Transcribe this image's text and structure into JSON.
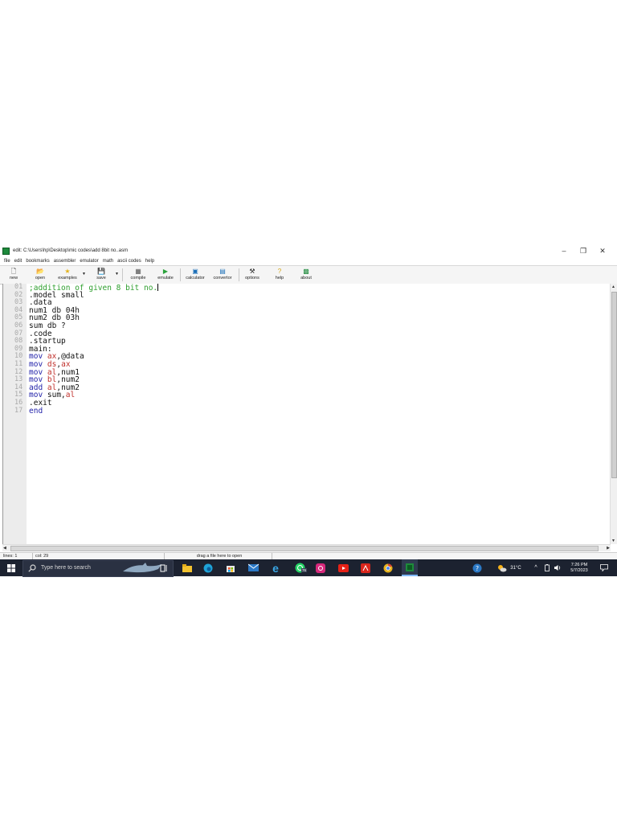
{
  "window": {
    "title": "edit: C:\\Users\\hp\\Desktop\\mic codes\\add 8bit no..asm",
    "controls": [
      "–",
      "❐",
      "✕"
    ]
  },
  "menu": [
    "file",
    "edit",
    "bookmarks",
    "assembler",
    "emulator",
    "math",
    "ascii codes",
    "help"
  ],
  "toolbar": {
    "new": "new",
    "open": "open",
    "examples": "examples",
    "save": "save",
    "compile": "compile",
    "emulate": "emulate",
    "calculator": "calculator",
    "convertor": "convertor",
    "options": "options",
    "help": "help",
    "about": "about"
  },
  "editor": {
    "colors": {
      "comment": "#2e9e2e",
      "keyword": "#1f1fa8",
      "register": "#c0302b",
      "text": "#111111"
    },
    "lines": [
      {
        "n": "01",
        "segments": [
          {
            "t": ";addition of given 8 bit no.",
            "c": "comment"
          }
        ]
      },
      {
        "n": "02",
        "segments": [
          {
            "t": ".model small",
            "c": "text"
          }
        ]
      },
      {
        "n": "03",
        "segments": [
          {
            "t": ".data",
            "c": "text"
          }
        ]
      },
      {
        "n": "04",
        "segments": [
          {
            "t": "num1 db 04h",
            "c": "text"
          }
        ]
      },
      {
        "n": "05",
        "segments": [
          {
            "t": "num2 db 03h",
            "c": "text"
          }
        ]
      },
      {
        "n": "06",
        "segments": [
          {
            "t": "sum db ?",
            "c": "text"
          }
        ]
      },
      {
        "n": "07",
        "segments": [
          {
            "t": ".code",
            "c": "text"
          }
        ]
      },
      {
        "n": "08",
        "segments": [
          {
            "t": ".startup",
            "c": "text"
          }
        ]
      },
      {
        "n": "09",
        "segments": [
          {
            "t": "main:",
            "c": "text"
          }
        ]
      },
      {
        "n": "10",
        "segments": [
          {
            "t": "mov",
            "c": "keyword"
          },
          {
            "t": " ",
            "c": "text"
          },
          {
            "t": "ax",
            "c": "register"
          },
          {
            "t": ",@data",
            "c": "text"
          }
        ]
      },
      {
        "n": "11",
        "segments": [
          {
            "t": "mov",
            "c": "keyword"
          },
          {
            "t": " ",
            "c": "text"
          },
          {
            "t": "ds",
            "c": "register"
          },
          {
            "t": ",",
            "c": "text"
          },
          {
            "t": "ax",
            "c": "register"
          }
        ]
      },
      {
        "n": "12",
        "segments": [
          {
            "t": "mov",
            "c": "keyword"
          },
          {
            "t": " ",
            "c": "text"
          },
          {
            "t": "al",
            "c": "register"
          },
          {
            "t": ",num1",
            "c": "text"
          }
        ]
      },
      {
        "n": "13",
        "segments": [
          {
            "t": "mov",
            "c": "keyword"
          },
          {
            "t": " ",
            "c": "text"
          },
          {
            "t": "bl",
            "c": "register"
          },
          {
            "t": ",num2",
            "c": "text"
          }
        ]
      },
      {
        "n": "14",
        "segments": [
          {
            "t": "add",
            "c": "keyword"
          },
          {
            "t": " ",
            "c": "text"
          },
          {
            "t": "al",
            "c": "register"
          },
          {
            "t": ",num2",
            "c": "text"
          }
        ]
      },
      {
        "n": "15",
        "segments": [
          {
            "t": "mov",
            "c": "keyword"
          },
          {
            "t": " sum,",
            "c": "text"
          },
          {
            "t": "al",
            "c": "register"
          }
        ]
      },
      {
        "n": "16",
        "segments": [
          {
            "t": ".exit",
            "c": "text"
          }
        ]
      },
      {
        "n": "17",
        "segments": [
          {
            "t": "end",
            "c": "keyword"
          }
        ]
      }
    ]
  },
  "status": {
    "lines": "lines: 1",
    "col": "col: 29",
    "hint": "drag a file here to open"
  },
  "taskbar": {
    "search_placeholder": "Type here to search",
    "whatsapp_badge": "76",
    "temperature": "31°C",
    "time": "7:26 PM",
    "date": "5/7/2023"
  }
}
